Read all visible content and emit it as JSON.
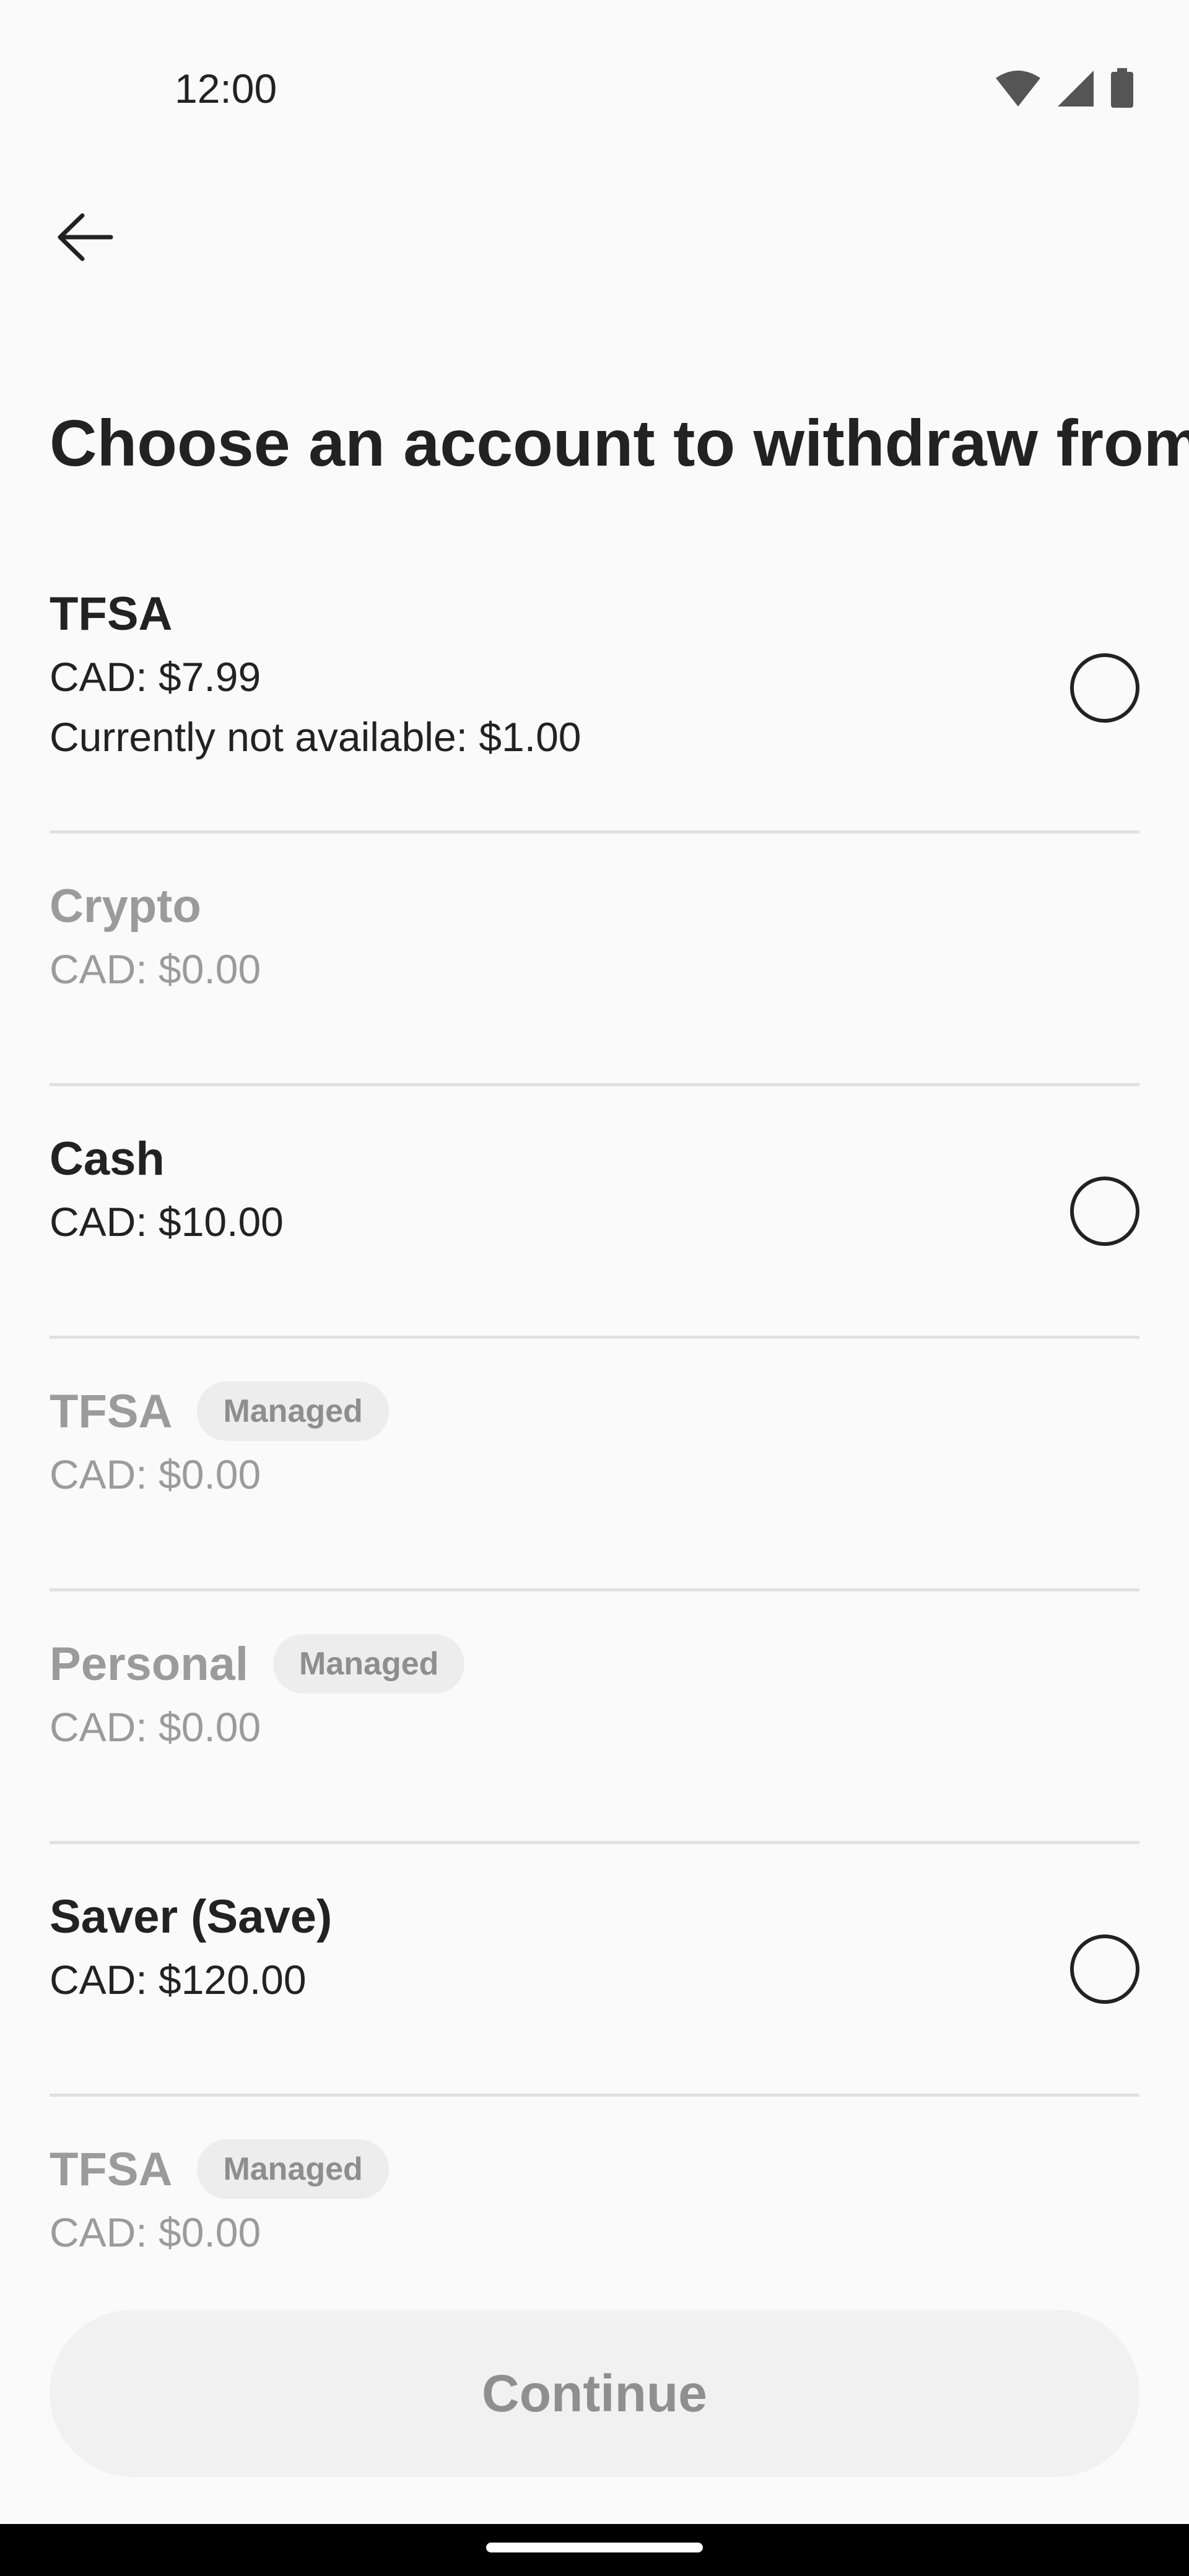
{
  "status_bar": {
    "time": "12:00",
    "icons": [
      "wifi-icon",
      "signal-icon",
      "battery-icon"
    ]
  },
  "header": {
    "title": "Choose an account to withdraw from",
    "back_icon": "arrow-left-icon"
  },
  "accounts": [
    {
      "name": "TFSA",
      "balance": "CAD: $7.99",
      "note": "Currently not available: $1.00",
      "badge": "",
      "disabled": false,
      "selectable": true
    },
    {
      "name": "Crypto",
      "balance": "CAD: $0.00",
      "note": "",
      "badge": "",
      "disabled": true,
      "selectable": false
    },
    {
      "name": "Cash",
      "balance": "CAD: $10.00",
      "note": "",
      "badge": "",
      "disabled": false,
      "selectable": true
    },
    {
      "name": "TFSA",
      "balance": "CAD: $0.00",
      "note": "",
      "badge": "Managed",
      "disabled": true,
      "selectable": false
    },
    {
      "name": "Personal",
      "balance": "CAD: $0.00",
      "note": "",
      "badge": "Managed",
      "disabled": true,
      "selectable": false
    },
    {
      "name": "Saver (Save)",
      "balance": "CAD: $120.00",
      "note": "",
      "badge": "",
      "disabled": false,
      "selectable": true
    },
    {
      "name": "TFSA",
      "balance": "CAD: $0.00",
      "note": "",
      "badge": "Managed",
      "disabled": true,
      "selectable": false
    }
  ],
  "footer": {
    "continue_label": "Continue"
  },
  "colors": {
    "text": "#222222",
    "muted": "#9B9B9B",
    "divider": "#E0E0E0",
    "button_bg": "#F1F1F1"
  }
}
